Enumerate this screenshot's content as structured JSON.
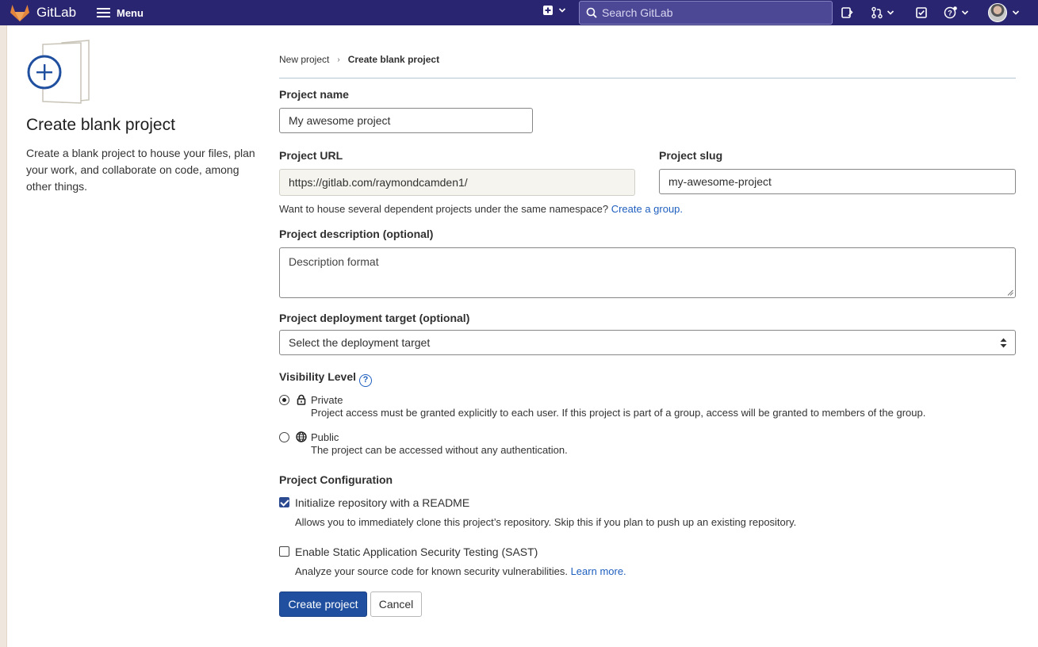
{
  "topbar": {
    "brand": "GitLab",
    "menu_label": "Menu",
    "search_placeholder": "Search GitLab",
    "colors": {
      "bar": "#2a2570",
      "logo": "#e2843c"
    }
  },
  "sidebar": {
    "title": "Create blank project",
    "description": "Create a blank project to house your files, plan your work, and collaborate on code, among other things."
  },
  "breadcrumb": {
    "items": [
      "New project",
      "Create blank project"
    ]
  },
  "form": {
    "project_name": {
      "label": "Project name",
      "value": "My awesome project"
    },
    "project_url": {
      "label": "Project URL",
      "value": "https://gitlab.com/raymondcamden1/"
    },
    "project_slug": {
      "label": "Project slug",
      "value": "my-awesome-project"
    },
    "namespace_help": {
      "text": "Want to house several dependent projects under the same namespace?",
      "link": "Create a group."
    },
    "description": {
      "label": "Project description (optional)",
      "placeholder": "Description format"
    },
    "deployment": {
      "label": "Project deployment target (optional)",
      "selected": "Select the deployment target"
    },
    "visibility": {
      "label": "Visibility Level",
      "help_icon": "?",
      "options": [
        {
          "title": "Private",
          "description": "Project access must be granted explicitly to each user. If this project is part of a group, access will be granted to members of the group.",
          "selected": true,
          "icon": "lock-icon"
        },
        {
          "title": "Public",
          "description": "The project can be accessed without any authentication.",
          "selected": false,
          "icon": "globe-icon"
        }
      ]
    },
    "configuration": {
      "label": "Project Configuration",
      "options": [
        {
          "title": "Initialize repository with a README",
          "description": "Allows you to immediately clone this project’s repository. Skip this if you plan to push up an existing repository.",
          "checked": true
        },
        {
          "title": "Enable Static Application Security Testing (SAST)",
          "description": "Analyze your source code for known security vulnerabilities.",
          "link": "Learn more.",
          "checked": false
        }
      ]
    },
    "buttons": {
      "create": "Create project",
      "cancel": "Cancel"
    }
  }
}
